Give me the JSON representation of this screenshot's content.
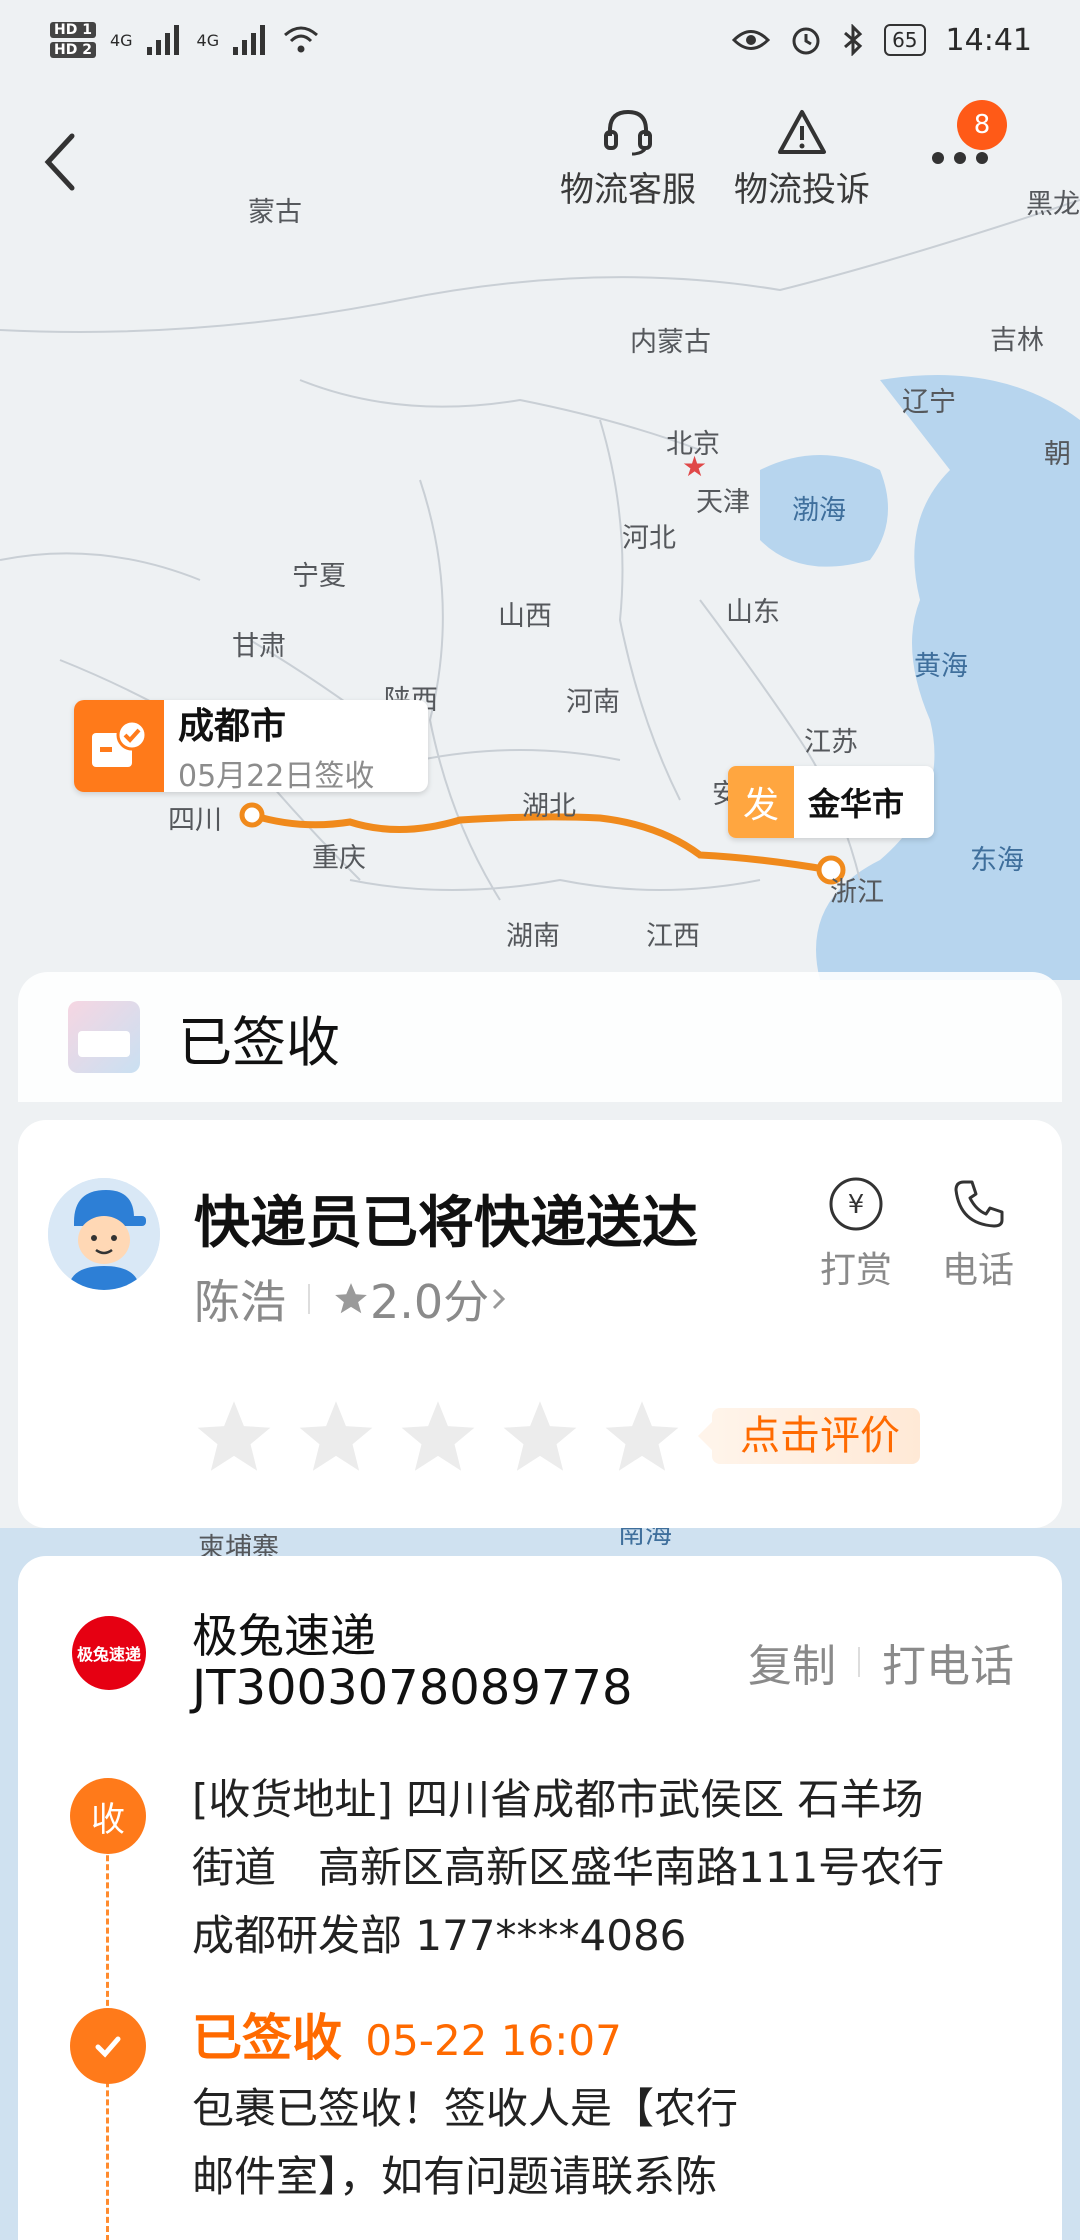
{
  "status_bar": {
    "sim1": "HD 1",
    "sim2": "HD 2",
    "signal1": "4G",
    "signal2": "4G",
    "battery": "65",
    "time": "14:41"
  },
  "nav": {
    "customer_service": "物流客服",
    "complaint": "物流投诉",
    "badge_count": "8"
  },
  "map": {
    "labels": [
      {
        "name": "mongolia",
        "text": "蒙古"
      },
      {
        "name": "heilongjiang",
        "text": "黑龙"
      },
      {
        "name": "inner-mongolia",
        "text": "内蒙古"
      },
      {
        "name": "jilin",
        "text": "吉林"
      },
      {
        "name": "liaoning",
        "text": "辽宁"
      },
      {
        "name": "korea",
        "text": "朝"
      },
      {
        "name": "beijing",
        "text": "北京"
      },
      {
        "name": "tianjin",
        "text": "天津"
      },
      {
        "name": "bohai",
        "text": "渤海"
      },
      {
        "name": "hebei",
        "text": "河北"
      },
      {
        "name": "ningxia",
        "text": "宁夏"
      },
      {
        "name": "shanxi",
        "text": "山西"
      },
      {
        "name": "shandong",
        "text": "山东"
      },
      {
        "name": "gansu",
        "text": "甘肃"
      },
      {
        "name": "huanghai",
        "text": "黄海"
      },
      {
        "name": "shaanxi",
        "text": "陕西"
      },
      {
        "name": "henan",
        "text": "河南"
      },
      {
        "name": "jiangsu",
        "text": "江苏"
      },
      {
        "name": "sichuan",
        "text": "四川"
      },
      {
        "name": "hubei",
        "text": "湖北"
      },
      {
        "name": "anhui",
        "text": "安"
      },
      {
        "name": "chongqing",
        "text": "重庆"
      },
      {
        "name": "donghai",
        "text": "东海"
      },
      {
        "name": "zhejiang",
        "text": "浙江"
      },
      {
        "name": "hunan",
        "text": "湖南"
      },
      {
        "name": "jiangxi",
        "text": "江西"
      },
      {
        "name": "cambodia",
        "text": "柬埔寨"
      },
      {
        "name": "nanhai",
        "text": "南海"
      }
    ],
    "destination": {
      "city": "成都市",
      "date": "05月22日签收"
    },
    "origin": {
      "tag": "发",
      "city": "金华市"
    }
  },
  "status_card": {
    "title": "已签收"
  },
  "courier_card": {
    "title": "快递员已将快递送达",
    "courier_name": "陈浩",
    "score": "2.0分",
    "tip_label": "打赏",
    "phone_label": "电话",
    "rating_prompt": "点击评价",
    "star_count": 5
  },
  "info_card": {
    "carrier_logo": "极兔速递",
    "carrier_name": "极兔速递",
    "tracking_number": "JT3003078089778",
    "copy_label": "复制",
    "call_label": "打电话",
    "receive_tag": "收",
    "address_lines": [
      "[收货地址] 四川省成都市武侯区 石羊场",
      "街道　高新区高新区盛华南路111号农行",
      "成都研发部 177****4086"
    ],
    "signed_status": "已签收",
    "signed_time": "05-22 16:07",
    "signed_detail_lines": [
      "包裹已签收！签收人是【农行",
      "邮件室】，如有问题请联系陈"
    ]
  },
  "colors": {
    "accent": "#ff6a00",
    "route": "#f08a1c",
    "badge": "#ff5a17",
    "sea": "#b7d5ee",
    "land": "#eef1f3"
  }
}
